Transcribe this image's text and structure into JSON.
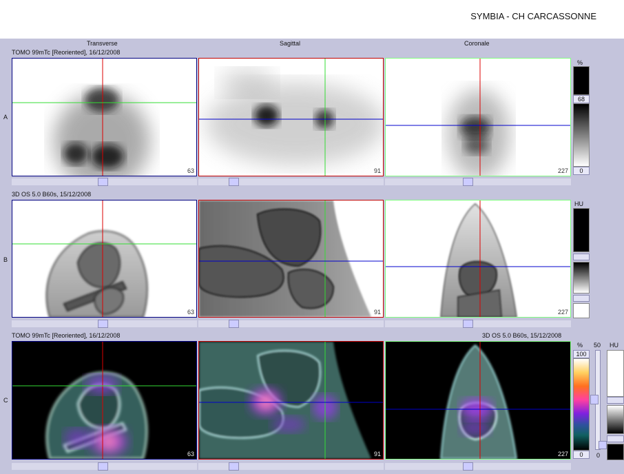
{
  "app": {
    "header_title": "SYMBIA - CH CARCASSONNE"
  },
  "columns": [
    "Transverse",
    "Sagittal",
    "Coronale"
  ],
  "rows": [
    {
      "letter": "A",
      "info_left": "TOMO 99mTc [Reoriented], 16/12/2008",
      "info_right": ""
    },
    {
      "letter": "B",
      "info_left": "3D  OS  5.0  B60s, 15/12/2008",
      "info_right": ""
    },
    {
      "letter": "C",
      "info_left": "TOMO 99mTc [Reoriented], 16/12/2008",
      "info_right": "3D  OS  5.0  B60s, 15/12/2008"
    }
  ],
  "slices": {
    "transverse": "63",
    "sagittal": "91",
    "coronal": "227"
  },
  "scales": {
    "a": {
      "unit": "%",
      "max": "68",
      "min": "0"
    },
    "b": {
      "unit": "HU"
    },
    "c_color": {
      "unit": "%",
      "max": "100",
      "min": "0"
    },
    "c_mid": {
      "label": "50",
      "min": "0"
    },
    "c_gray": {
      "unit": "HU"
    }
  },
  "colors": {
    "transverse_border": "#000080",
    "sagittal_border": "#c00000",
    "coronal_border": "#80ff80",
    "cross_red": "#dd0000",
    "cross_green": "#33dd33",
    "cross_blue": "#0000cc"
  }
}
